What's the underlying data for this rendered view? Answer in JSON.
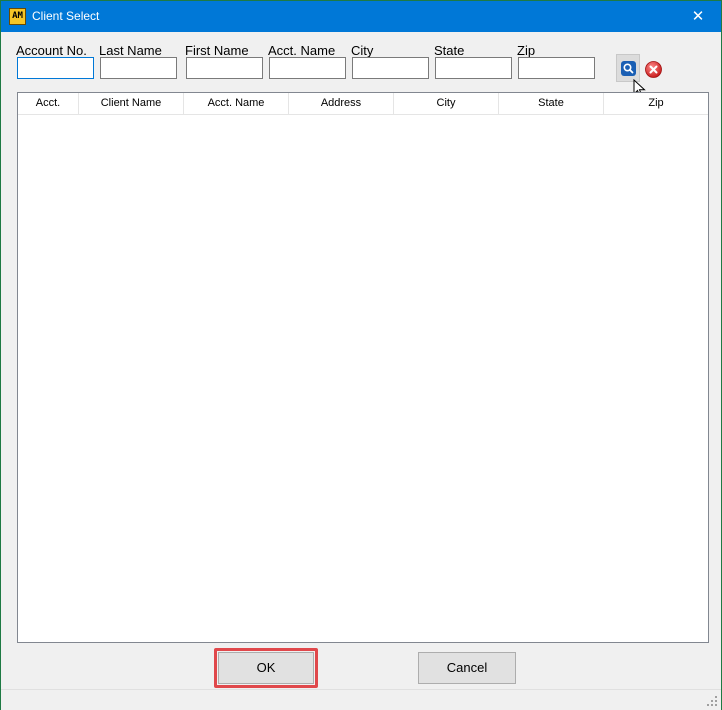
{
  "window": {
    "title": "Client Select",
    "app_icon_text": "AM",
    "close_glyph": "✕"
  },
  "filters": {
    "account_no": {
      "label": "Account No.",
      "value": ""
    },
    "last_name": {
      "label": "Last Name",
      "value": ""
    },
    "first_name": {
      "label": "First Name",
      "value": ""
    },
    "acct_name": {
      "label": "Acct. Name",
      "value": ""
    },
    "city": {
      "label": "City",
      "value": ""
    },
    "state": {
      "label": "State",
      "value": ""
    },
    "zip": {
      "label": "Zip",
      "value": ""
    },
    "search_icon": "search-icon",
    "clear_icon": "clear-icon"
  },
  "grid": {
    "columns": [
      "Acct.",
      "Client Name",
      "Acct. Name",
      "Address",
      "City",
      "State",
      "Zip"
    ],
    "rows": []
  },
  "buttons": {
    "ok": "OK",
    "cancel": "Cancel"
  },
  "colors": {
    "title_bar": "#0078d7",
    "highlight": "#e0484b",
    "focus_border": "#0078d7"
  }
}
